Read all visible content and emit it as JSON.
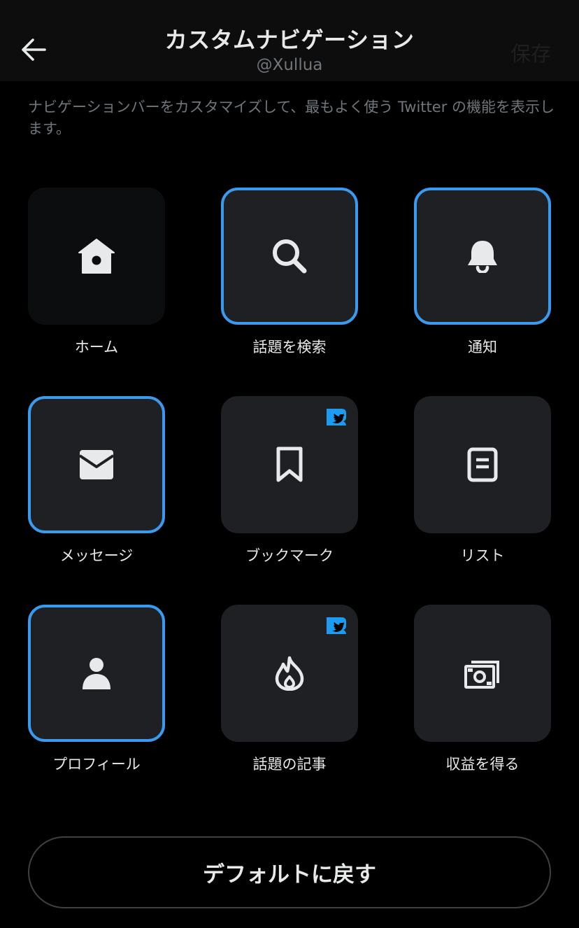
{
  "header": {
    "title": "カスタムナビゲーション",
    "handle": "@Xullua",
    "save_label": "保存",
    "back_icon": "arrow-left-icon"
  },
  "description": "ナビゲーションバーをカスタマイズして、最もよく使う Twitter の機能を表示します。",
  "colors": {
    "background": "#000000",
    "header_background": "#0d0d0d",
    "tile_background": "#1e2023",
    "selected_border": "#3a9bee",
    "badge": "#1d9bf0",
    "secondary_text": "#71767b"
  },
  "items": [
    {
      "label": "ホーム",
      "icon": "home-icon",
      "selected": false,
      "blue_badge": false
    },
    {
      "label": "話題を検索",
      "icon": "search-icon",
      "selected": true,
      "blue_badge": false
    },
    {
      "label": "通知",
      "icon": "bell-icon",
      "selected": true,
      "blue_badge": false
    },
    {
      "label": "メッセージ",
      "icon": "envelope-icon",
      "selected": true,
      "blue_badge": false
    },
    {
      "label": "ブックマーク",
      "icon": "bookmark-icon",
      "selected": false,
      "blue_badge": true
    },
    {
      "label": "リスト",
      "icon": "list-icon",
      "selected": false,
      "blue_badge": false
    },
    {
      "label": "プロフィール",
      "icon": "person-icon",
      "selected": true,
      "blue_badge": false
    },
    {
      "label": "話題の記事",
      "icon": "flame-icon",
      "selected": false,
      "blue_badge": true
    },
    {
      "label": "収益を得る",
      "icon": "money-icon",
      "selected": false,
      "blue_badge": false
    }
  ],
  "reset_label": "デフォルトに戻す"
}
